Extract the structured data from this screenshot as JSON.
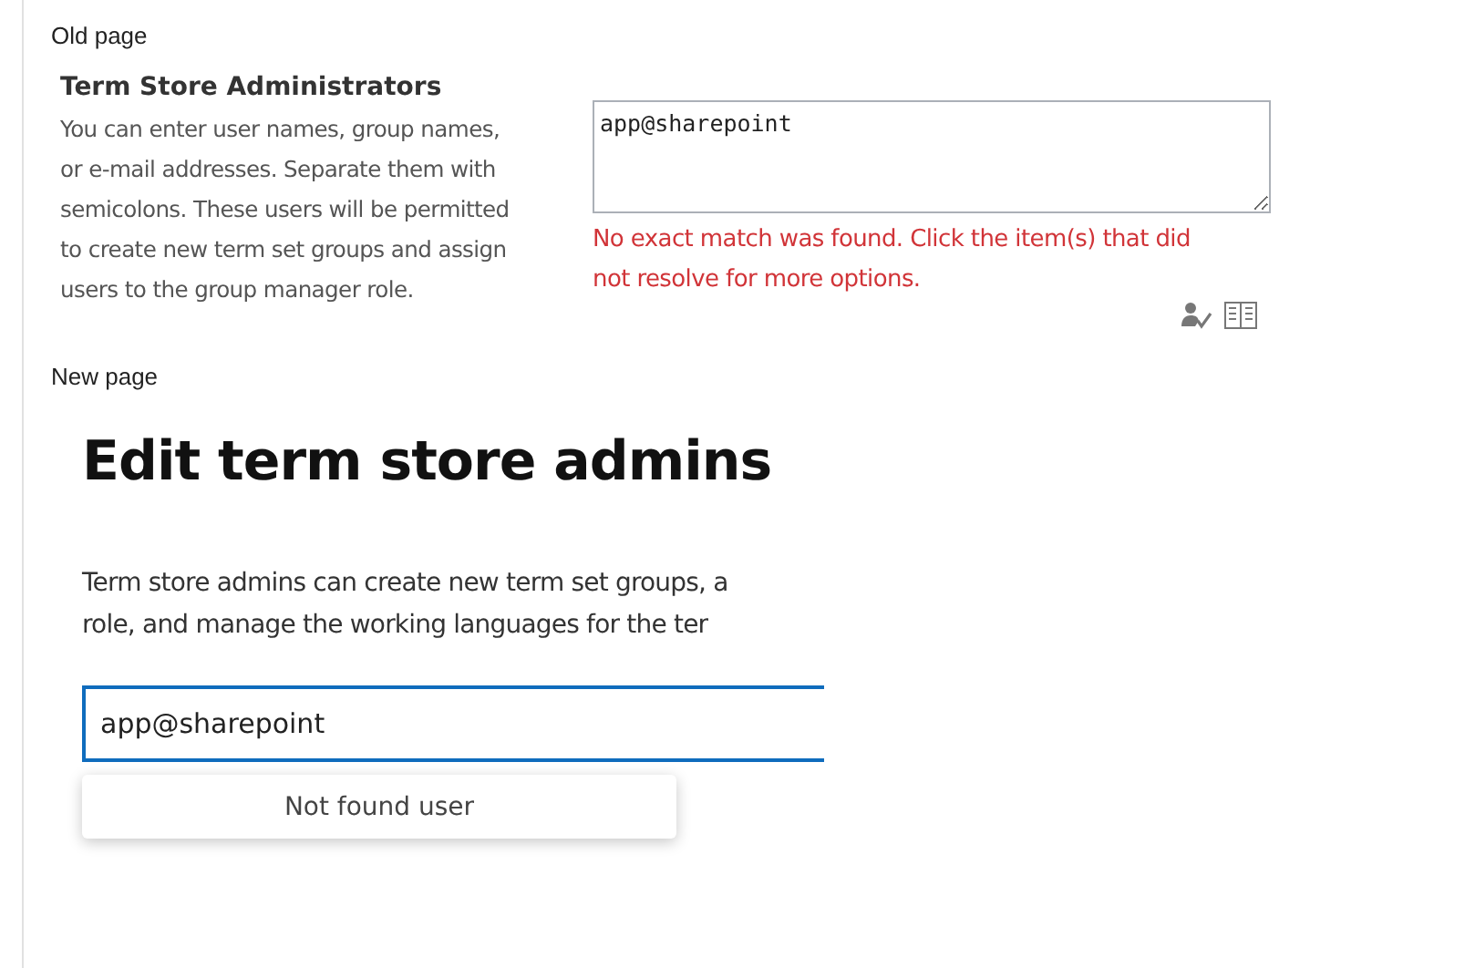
{
  "old_page": {
    "label": "Old page",
    "title": "Term Store Administrators",
    "description": "You can enter user names, group names, or e-mail addresses. Separate them with semicolons. These users will be permitted to create new term set groups and assign users to the group manager role.",
    "field": {
      "value": "app@sharepoint"
    },
    "error": "No exact match was found. Click the item(s) that did not resolve for more options."
  },
  "new_page": {
    "label": "New page",
    "title": "Edit term store admins",
    "description_lines": [
      "Term store admins can create new term set groups, a",
      "role, and manage the working languages for the ter"
    ],
    "field": {
      "value": "app@sharepoint"
    },
    "suggestion": "Not found user"
  }
}
